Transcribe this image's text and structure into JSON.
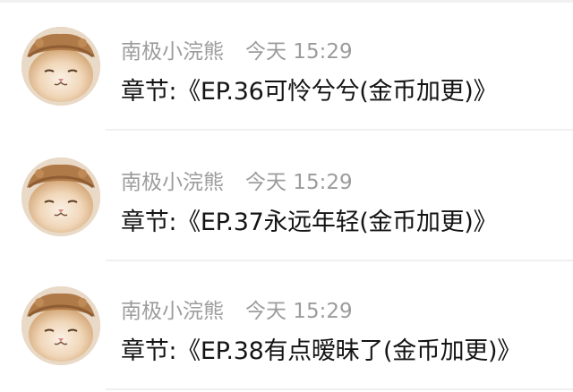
{
  "messages": [
    {
      "author": "南极小浣熊",
      "time": "今天 15:29",
      "text": "章节:《EP.36可怜兮兮(金币加更)》",
      "avatar_icon": "cat-wearing-hat-avatar"
    },
    {
      "author": "南极小浣熊",
      "time": "今天 15:29",
      "text": "章节:《EP.37永远年轻(金币加更)》",
      "avatar_icon": "cat-wearing-hat-avatar"
    },
    {
      "author": "南极小浣熊",
      "time": "今天 15:29",
      "text": "章节:《EP.38有点暧昧了(金币加更)》",
      "avatar_icon": "cat-wearing-hat-avatar"
    }
  ],
  "colors": {
    "meta_text": "#9c9c9c",
    "message_text": "#141414",
    "divider": "#f0f0f0"
  }
}
